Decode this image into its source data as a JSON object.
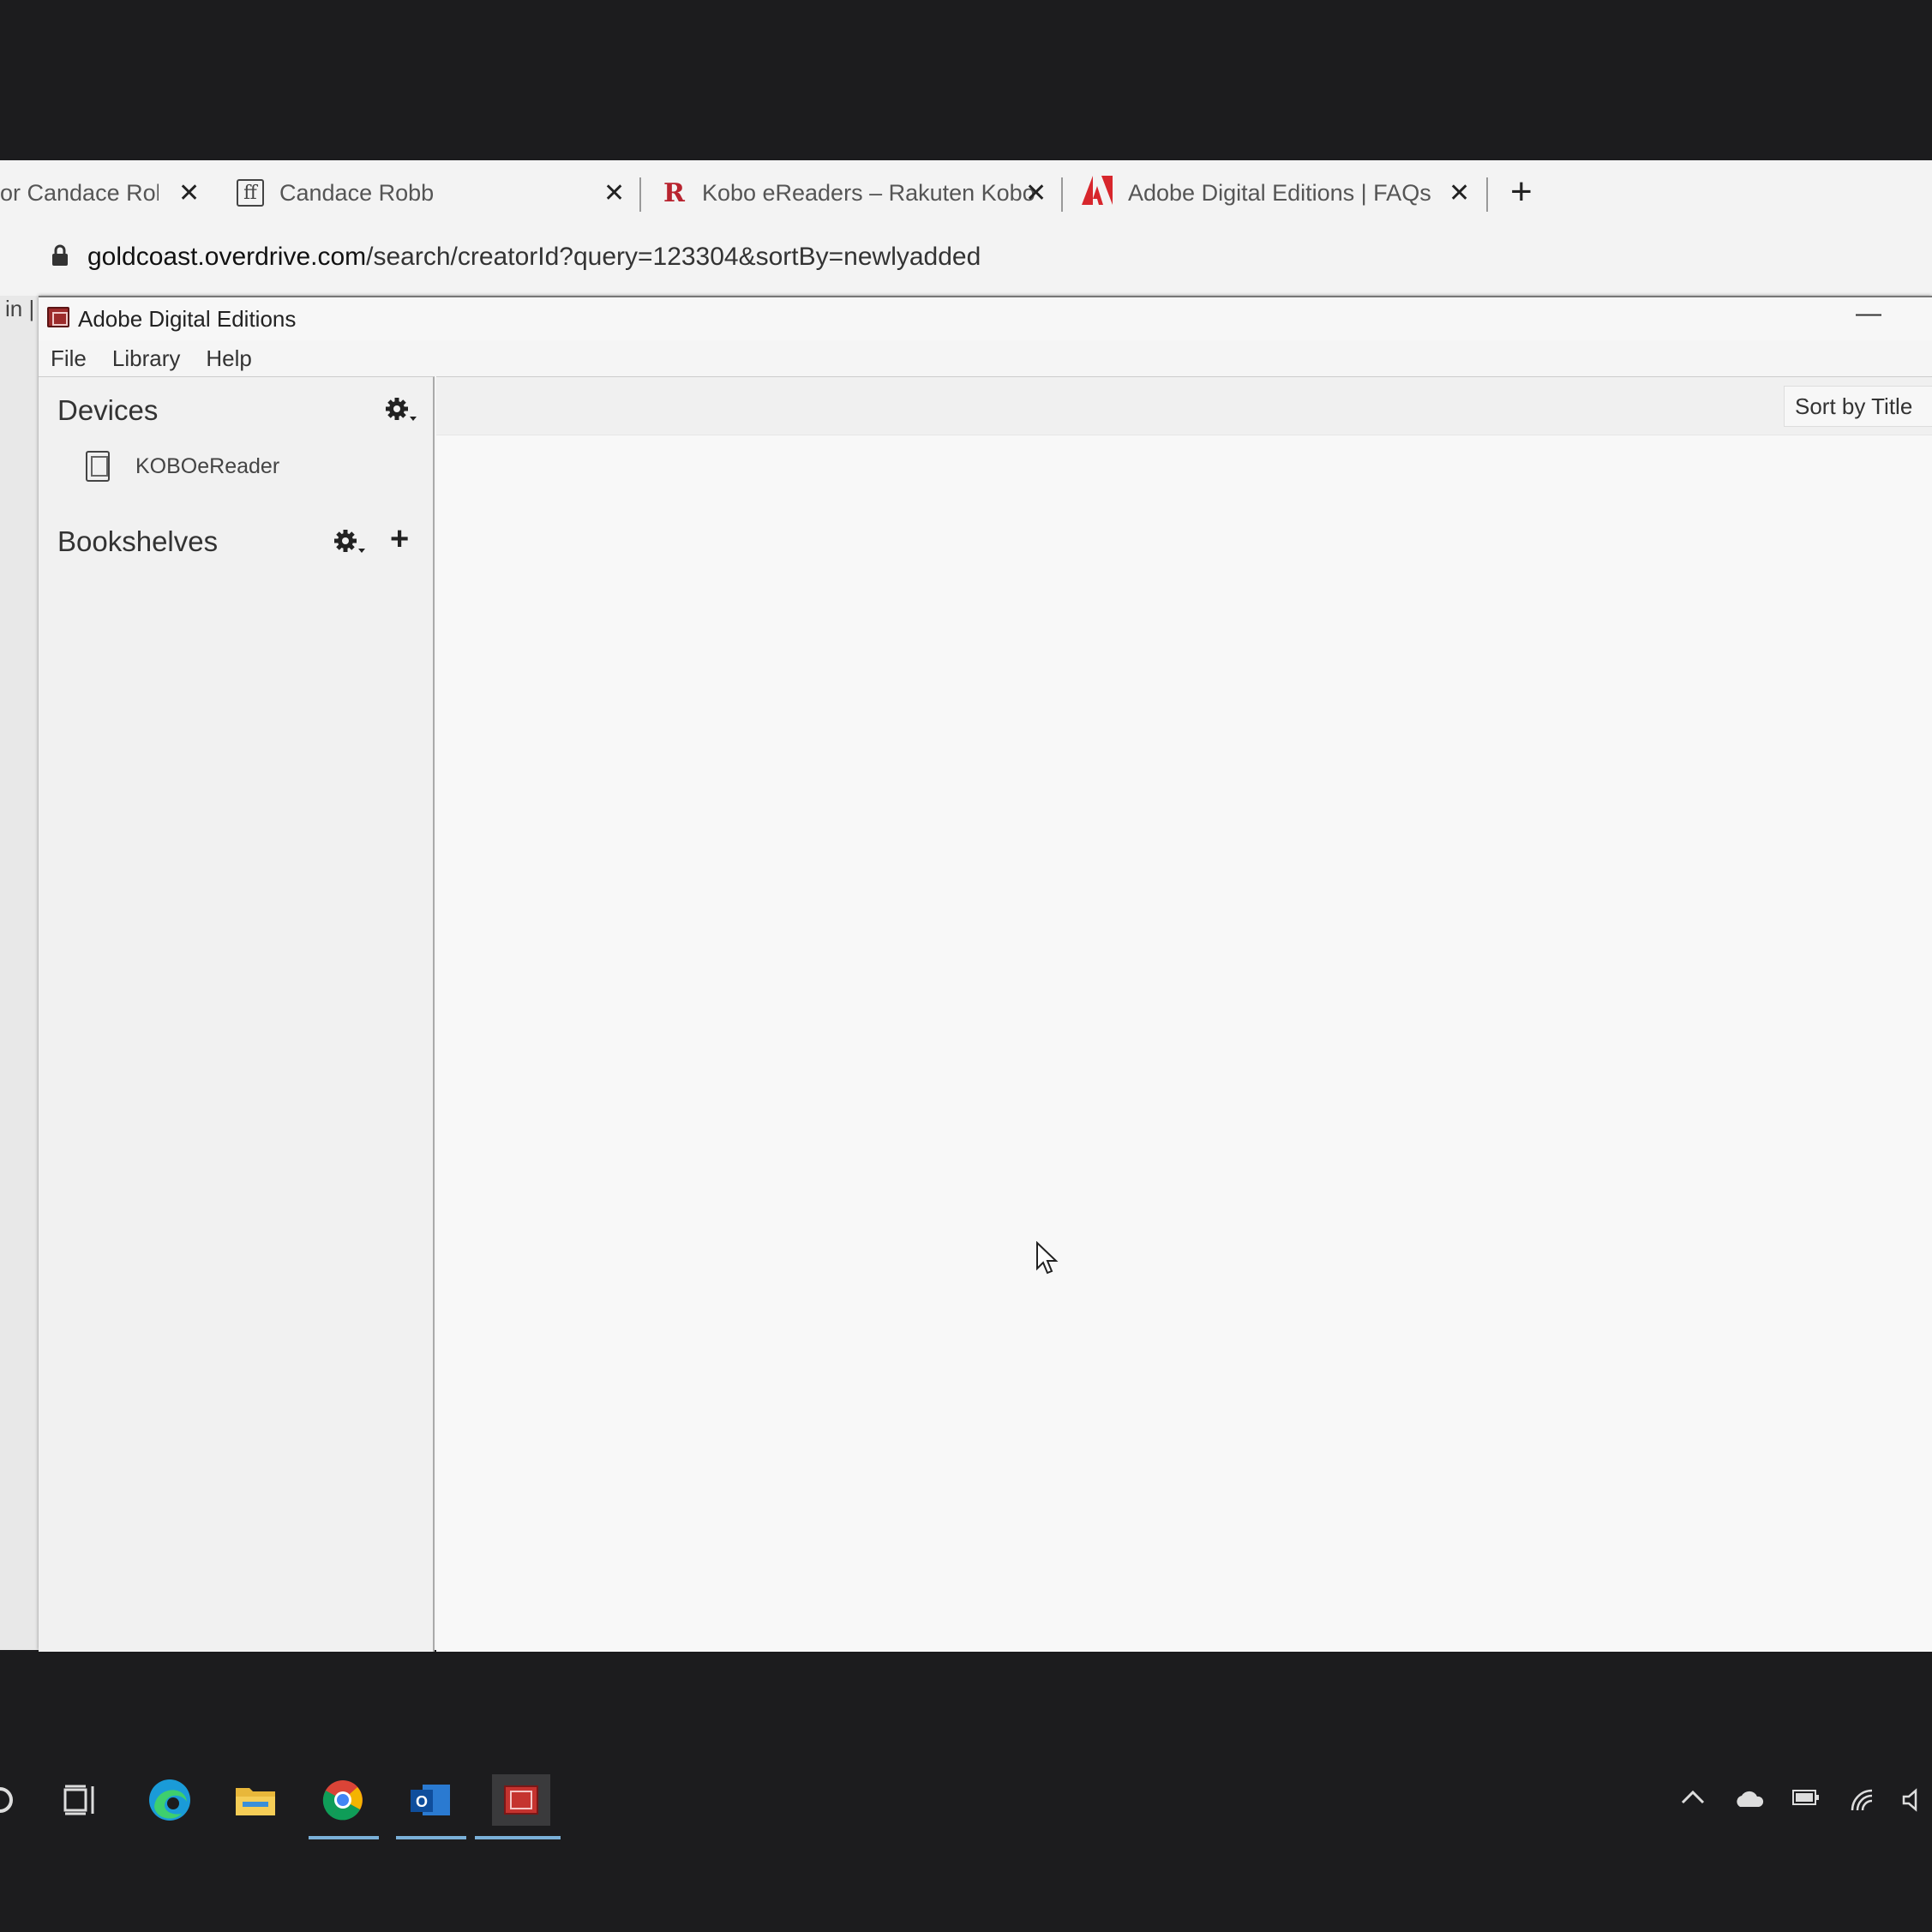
{
  "browser": {
    "tabs": [
      {
        "title": "or Candace Robb",
        "close": "✕"
      },
      {
        "title": "Candace Robb",
        "favicon": "ff",
        "close": "✕"
      },
      {
        "title": "Kobo eReaders – Rakuten Kobo",
        "favicon": "R",
        "close": "✕"
      },
      {
        "title": "Adobe Digital Editions | FAQs",
        "close": "✕"
      }
    ],
    "new_tab": "+",
    "url_host": "goldcoast.overdrive.com",
    "url_path": "/search/creatorId?query=123304&sortBy=newlyadded",
    "left_fragment": "in |"
  },
  "ade": {
    "title": "Adobe Digital Editions",
    "minimize": "—",
    "menu": [
      "File",
      "Library",
      "Help"
    ],
    "sidebar": {
      "devices_title": "Devices",
      "device_name": "KOBOeReader",
      "bookshelves_title": "Bookshelves",
      "add": "+"
    },
    "sort_label": "Sort by Title"
  },
  "colors": {
    "desktop": "#1c1c1e",
    "ade_icon": "#9c2b2b",
    "kobo_red": "#b8232f",
    "adobe_red": "#d7262c"
  },
  "icons": [
    "lock-icon",
    "gear-icon",
    "plus-icon",
    "ereader-icon",
    "edge-icon",
    "file-explorer-icon",
    "chrome-icon",
    "outlook-icon",
    "ade-icon",
    "task-view-icon",
    "onedrive-icon",
    "battery-icon",
    "wifi-icon",
    "volume-icon"
  ]
}
